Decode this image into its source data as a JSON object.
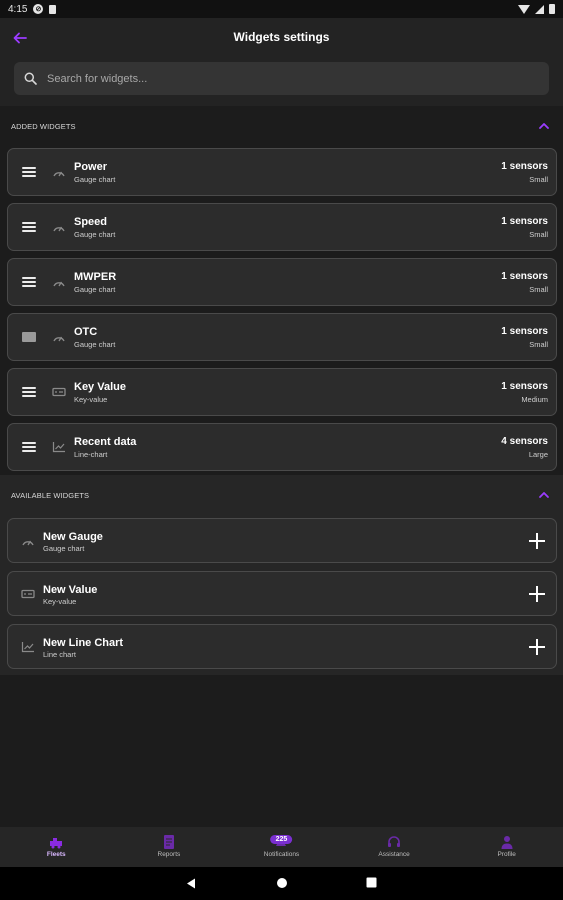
{
  "status_bar": {
    "time": "4:15"
  },
  "header": {
    "title": "Widgets settings",
    "search_placeholder": "Search for widgets..."
  },
  "added_widgets": {
    "title": "ADDED WIDGETS",
    "items": [
      {
        "name": "Power",
        "type": "Gauge chart",
        "icon": "gauge-icon",
        "sensors": "1 sensors",
        "size": "Small"
      },
      {
        "name": "Speed",
        "type": "Gauge chart",
        "icon": "gauge-icon",
        "sensors": "1 sensors",
        "size": "Small"
      },
      {
        "name": "MWPER",
        "type": "Gauge chart",
        "icon": "gauge-icon",
        "sensors": "1 sensors",
        "size": "Small"
      },
      {
        "name": "OTC",
        "type": "Gauge chart",
        "icon": "gauge-icon",
        "sensors": "1 sensors",
        "size": "Small"
      },
      {
        "name": "Key Value",
        "type": "Key-value",
        "icon": "key-value-icon",
        "sensors": "1 sensors",
        "size": "Medium"
      },
      {
        "name": "Recent data",
        "type": "Line-chart",
        "icon": "line-chart-icon",
        "sensors": "4 sensors",
        "size": "Large"
      }
    ]
  },
  "available_widgets": {
    "title": "AVAILABLE WIDGETS",
    "items": [
      {
        "name": "New Gauge",
        "type": "Gauge chart",
        "icon": "gauge-icon"
      },
      {
        "name": "New Value",
        "type": "Key-value",
        "icon": "key-value-icon"
      },
      {
        "name": "New Line Chart",
        "type": "Line chart",
        "icon": "line-chart-icon"
      }
    ]
  },
  "bottom_nav": {
    "items": [
      {
        "label": "Fleets",
        "icon": "fleets-icon",
        "active": true
      },
      {
        "label": "Reports",
        "icon": "reports-icon",
        "active": false
      },
      {
        "label": "Notifications",
        "icon": "notifications-icon",
        "active": false,
        "badge": "225"
      },
      {
        "label": "Assistance",
        "icon": "assistance-icon",
        "active": false
      },
      {
        "label": "Profile",
        "icon": "profile-icon",
        "active": false
      }
    ]
  },
  "colors": {
    "accent": "#9b3cff",
    "background": "#1c1c1c",
    "card": "#2c2c2c",
    "card_border": "#4a4a4a"
  }
}
